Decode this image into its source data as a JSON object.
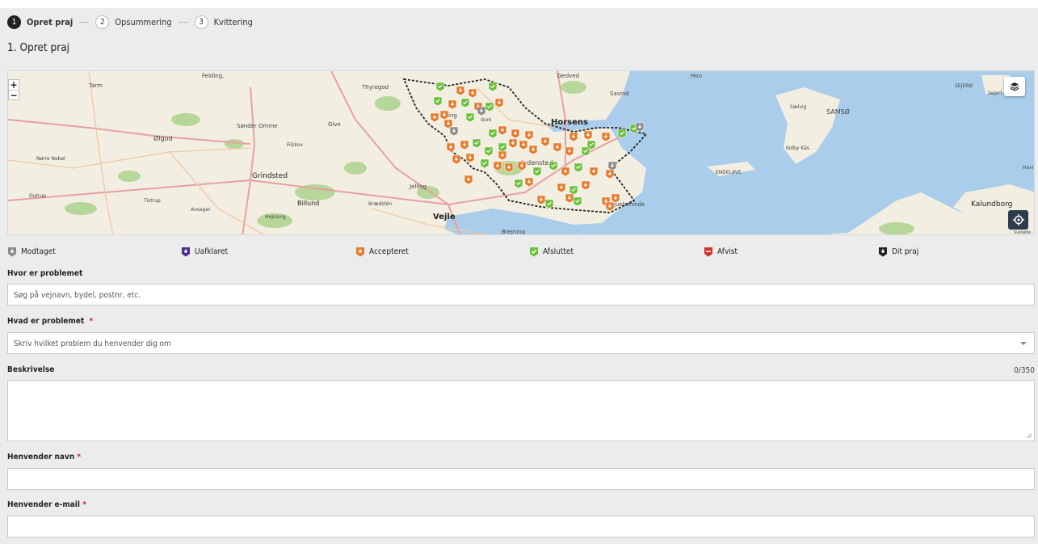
{
  "stepper": {
    "steps": [
      {
        "num": "1",
        "label": "Opret praj"
      },
      {
        "num": "2",
        "label": "Opsummering"
      },
      {
        "num": "3",
        "label": "Kvittering"
      }
    ]
  },
  "page_title": "1. Opret praj",
  "map": {
    "zoom_in": "+",
    "zoom_out": "−",
    "places": [
      {
        "name": "Feldingˌ"
      },
      {
        "name": "Tarm"
      },
      {
        "name": "Thyregod"
      },
      {
        "name": "Gedved"
      },
      {
        "name": "Hou"
      },
      {
        "name": "SEJERØ"
      },
      {
        "name": "Sejerl"
      },
      {
        "name": "Savind"
      },
      {
        "name": "Sælvig"
      },
      {
        "name": "SAMSØ"
      },
      {
        "name": "Horsens"
      },
      {
        "name": "Sønder Omme"
      },
      {
        "name": "Give"
      },
      {
        "name": "Ølgod"
      },
      {
        "name": "Filskov"
      },
      {
        "name": "Kolby Kås"
      },
      {
        "name": "Nørre Nebel"
      },
      {
        "name": "Grindsted"
      },
      {
        "name": "ENDELAVE"
      },
      {
        "name": "Havr"
      },
      {
        "name": "Jelling"
      },
      {
        "name": "Outrup"
      },
      {
        "name": "Tistrup"
      },
      {
        "name": "Billund"
      },
      {
        "name": "Brædstén"
      },
      {
        "name": "Juelsminde"
      },
      {
        "name": "Kalundborg"
      },
      {
        "name": "Ansager"
      },
      {
        "name": "Hejnsvig"
      },
      {
        "name": "Vejle"
      },
      {
        "name": "Brejning"
      },
      {
        "name": "Svebølle"
      },
      {
        "name": "ledensted"
      },
      {
        "name": "dum"
      },
      {
        "name": "ing"
      }
    ],
    "colors": {
      "land": "#f2eee2",
      "sea": "#a9cdea",
      "forest": "#b7d79a",
      "road": "#e8a0a0",
      "received": "#8a8a8a",
      "unclear": "#4a2a8c",
      "accepted": "#e57a2b",
      "done": "#6bbf3b",
      "rejected": "#d0312d",
      "mine": "#222222"
    }
  },
  "legend": [
    {
      "label": "Modtaget",
      "icon": "pin-received-icon",
      "color": "#8a8a8a"
    },
    {
      "label": "Uafklaret",
      "icon": "pin-unclear-icon",
      "color": "#4a2a8c"
    },
    {
      "label": "Accepteret",
      "icon": "pin-accepted-icon",
      "color": "#e57a2b"
    },
    {
      "label": "Afsluttet",
      "icon": "pin-done-icon",
      "color": "#6bbf3b"
    },
    {
      "label": "Afvist",
      "icon": "pin-rejected-icon",
      "color": "#d0312d"
    },
    {
      "label": "Dit praj",
      "icon": "pin-mine-icon",
      "color": "#222222"
    }
  ],
  "form": {
    "where_label": "Hvor er problemet",
    "where_placeholder": "Søg på vejnavn, bydel, postnr, etc.",
    "what_label": "Hvad er problemet",
    "what_required": "*",
    "what_placeholder": "Skriv hvilket problem du henvender dig om",
    "desc_label": "Beskrivelse",
    "desc_counter": "0/350",
    "name_label": "Henvender navn",
    "name_required": "*",
    "email_label": "Henvender e-mail",
    "email_required": "*"
  }
}
